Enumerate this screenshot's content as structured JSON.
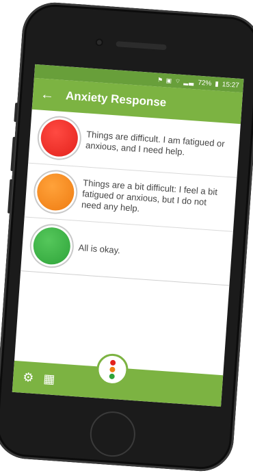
{
  "status_bar": {
    "icons": "⚑ ▣ ⌔ ▂▃",
    "battery": "72%",
    "time": "15:27"
  },
  "toolbar": {
    "back_icon": "←",
    "title": "Anxiety Response"
  },
  "options": [
    {
      "color": "red",
      "text": "Things are difficult. I am fatigued or anxious, and I need help."
    },
    {
      "color": "orange",
      "text": "Things are a bit difficult: I feel a bit fatigued or anxious, but I do not need any help."
    },
    {
      "color": "green",
      "text": "All is okay."
    }
  ],
  "bottom_bar": {
    "settings_icon": "⚙",
    "calendar_icon": "▦"
  },
  "colors": {
    "primary": "#7cb342",
    "status": "#689f3a",
    "red": "#e3221c",
    "orange": "#ef7c12",
    "green": "#2fa43a"
  }
}
